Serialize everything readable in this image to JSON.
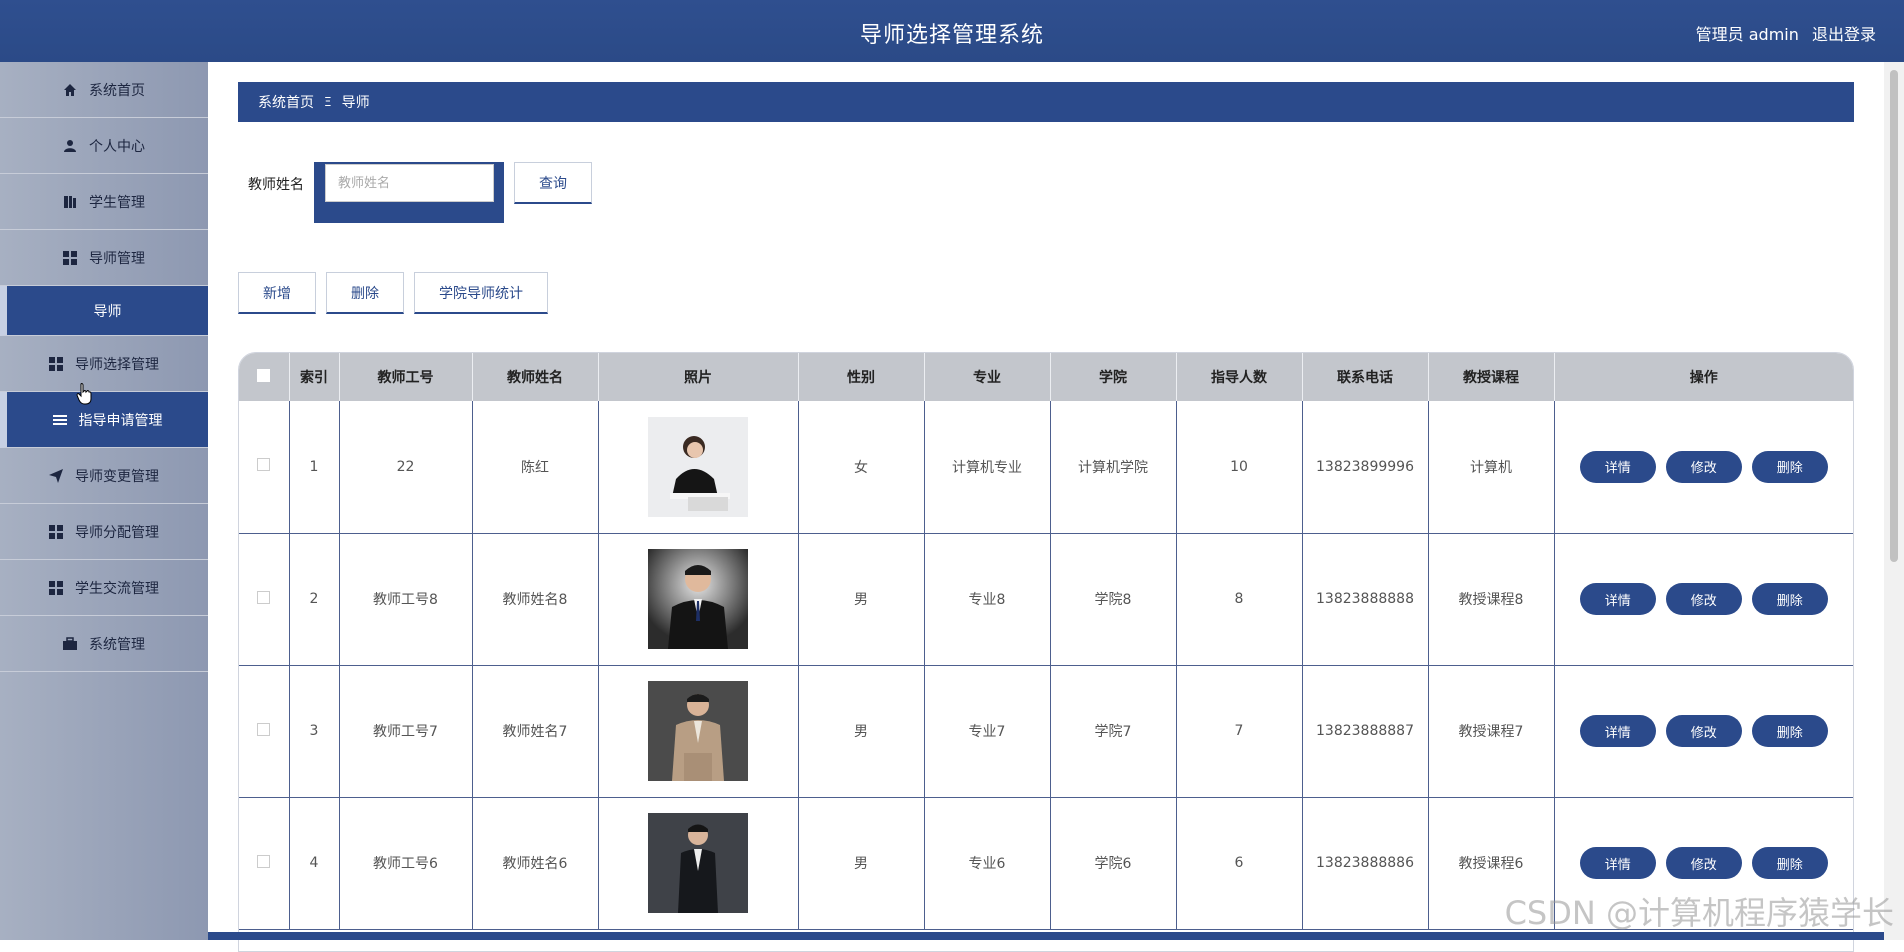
{
  "header": {
    "title": "导师选择管理系统",
    "user_label": "管理员 admin",
    "logout": "退出登录"
  },
  "sidebar": {
    "items": [
      {
        "label": "系统首页",
        "icon": "home-icon"
      },
      {
        "label": "个人中心",
        "icon": "user-icon"
      },
      {
        "label": "学生管理",
        "icon": "book-icon"
      },
      {
        "label": "导师管理",
        "icon": "grid-icon"
      },
      {
        "label": "导师",
        "icon": ""
      },
      {
        "label": "导师选择管理",
        "icon": "grid-icon"
      },
      {
        "label": "指导申请管理",
        "icon": "list-icon"
      },
      {
        "label": "导师变更管理",
        "icon": "send-icon"
      },
      {
        "label": "导师分配管理",
        "icon": "grid-icon"
      },
      {
        "label": "学生交流管理",
        "icon": "grid-icon"
      },
      {
        "label": "系统管理",
        "icon": "briefcase-icon"
      }
    ]
  },
  "breadcrumb": {
    "home": "系统首页",
    "separator": "Ξ",
    "current": "导师"
  },
  "search": {
    "label": "教师姓名",
    "placeholder": "教师姓名",
    "button": "查询"
  },
  "actions": {
    "add": "新增",
    "delete": "删除",
    "stats": "学院导师统计"
  },
  "table": {
    "headers": [
      "索引",
      "教师工号",
      "教师姓名",
      "照片",
      "性别",
      "专业",
      "学院",
      "指导人数",
      "联系电话",
      "教授课程",
      "操作"
    ],
    "rows": [
      {
        "index": "1",
        "id": "22",
        "name": "陈红",
        "gender": "女",
        "major": "计算机专业",
        "college": "计算机学院",
        "count": "10",
        "phone": "13823899996",
        "course": "计算机"
      },
      {
        "index": "2",
        "id": "教师工号8",
        "name": "教师姓名8",
        "gender": "男",
        "major": "专业8",
        "college": "学院8",
        "count": "8",
        "phone": "13823888888",
        "course": "教授课程8"
      },
      {
        "index": "3",
        "id": "教师工号7",
        "name": "教师姓名7",
        "gender": "男",
        "major": "专业7",
        "college": "学院7",
        "count": "7",
        "phone": "13823888887",
        "course": "教授课程7"
      },
      {
        "index": "4",
        "id": "教师工号6",
        "name": "教师姓名6",
        "gender": "男",
        "major": "专业6",
        "college": "学院6",
        "count": "6",
        "phone": "13823888886",
        "course": "教授课程6"
      }
    ],
    "row_buttons": {
      "detail": "详情",
      "edit": "修改",
      "delete": "删除"
    }
  },
  "watermark": "CSDN @计算机程序猿学长",
  "colors": {
    "primary": "#2b4a8b",
    "sidebar": "#9aa3b8",
    "header_bg": "#c3c6cc"
  }
}
